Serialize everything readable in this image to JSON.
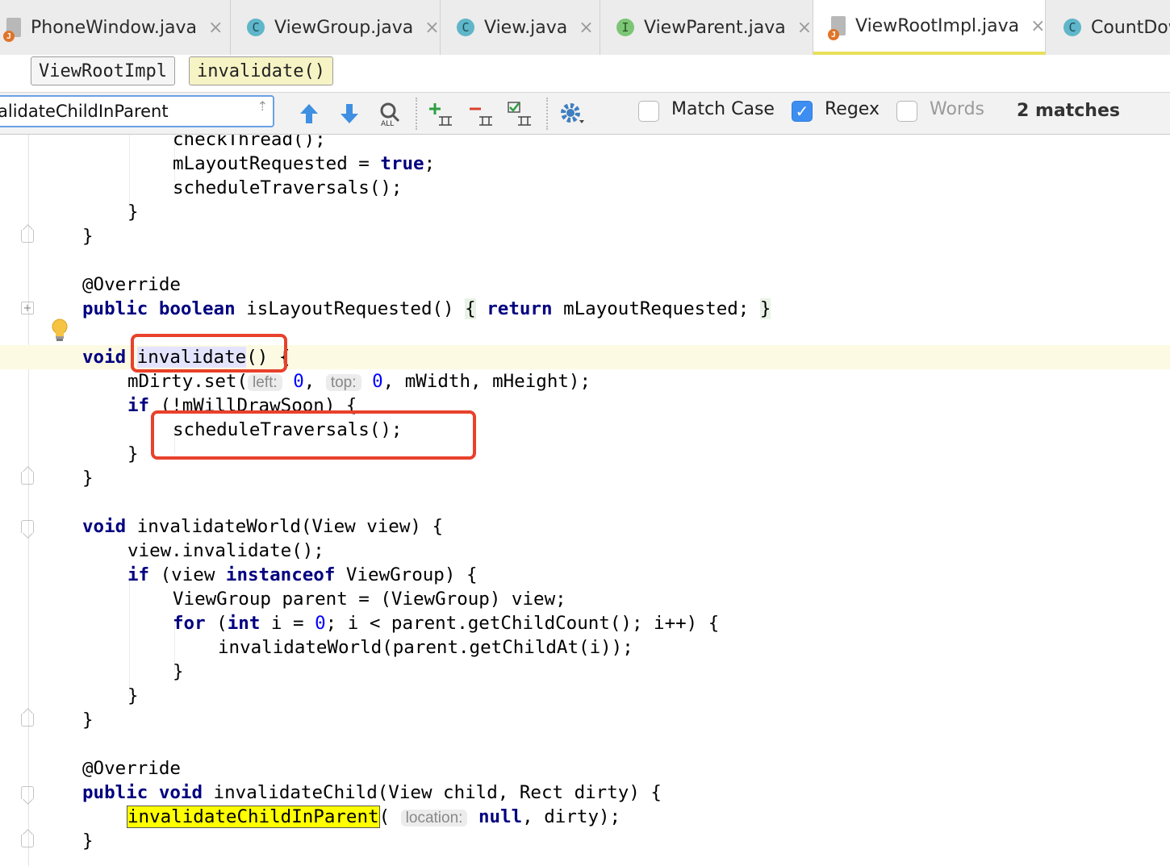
{
  "tabs": [
    {
      "label": "PhoneWindow.java",
      "icon": "java-file-icon",
      "active": false
    },
    {
      "label": "ViewGroup.java",
      "icon": "class-icon",
      "icon_letter": "C",
      "active": false
    },
    {
      "label": "View.java",
      "icon": "class-icon",
      "icon_letter": "C",
      "active": false
    },
    {
      "label": "ViewParent.java",
      "icon": "interface-icon",
      "icon_letter": "I",
      "active": false
    },
    {
      "label": "ViewRootImpl.java",
      "icon": "java-file-icon",
      "active": true
    },
    {
      "label": "CountDow",
      "icon": "class-icon",
      "icon_letter": "C",
      "active": false
    }
  ],
  "close_glyph": "×",
  "breadcrumb": {
    "class": "ViewRootImpl",
    "method": "invalidate()"
  },
  "find": {
    "query": "alidateChildInParent",
    "match_case_label": "Match Case",
    "match_case_checked": false,
    "regex_label": "Regex",
    "regex_checked": true,
    "words_label": "Words",
    "words_checked": false,
    "matches": "2 matches",
    "toolbar_icons": [
      "previous-occurrence-icon",
      "next-occurrence-icon",
      "find-all-icon",
      "add-occurrence-icon",
      "remove-occurrence-icon",
      "select-all-occurrences-icon",
      "settings-icon"
    ]
  },
  "code": {
    "l1": "checkThread();",
    "l2a": "mLayoutRequested = ",
    "l2kw": "true",
    "l2b": ";",
    "l3": "scheduleTraversals();",
    "l4": "}",
    "l5": "}",
    "l7": "@Override",
    "l8kw1": "public",
    "l8kw2": "boolean",
    "l8a": "isLayoutRequested()",
    "l8b": "{",
    "l8kw3": "return",
    "l8c": "mLayoutRequested;",
    "l8d": "}",
    "l10kw": "void",
    "l10sel": "invalidate",
    "l10a": "()",
    "l10b": "{",
    "l11a": "mDirty.set(",
    "l11hint1": "left:",
    "l11num1": "0",
    "l11b": ",",
    "l11hint2": "top:",
    "l11num2": "0",
    "l11c": ", mWidth, mHeight);",
    "l12kw": "if",
    "l12a": " (!mWillDrawSoon) {",
    "l13": "scheduleTraversals();",
    "l14": "}",
    "l15": "}",
    "l17kw": "void",
    "l17a": " invalidateWorld(View view) {",
    "l18": "view.invalidate();",
    "l19kw": "if",
    "l19a": " (view ",
    "l19kw2": "instanceof",
    "l19b": " ViewGroup) {",
    "l20": "ViewGroup parent = (ViewGroup) view;",
    "l21kw": "for",
    "l21a": " (",
    "l21kw2": "int",
    "l21b": " i = ",
    "l21num": "0",
    "l21c": "; i < parent.getChildCount(); i++) {",
    "l22": "invalidateWorld(parent.getChildAt(i));",
    "l23": "}",
    "l24": "}",
    "l25": "}",
    "l27": "@Override",
    "l28kw1": "public",
    "l28kw2": "void",
    "l28a": " invalidateChild(View child, Rect dirty) {",
    "l29hl": "invalidateChildInParent",
    "l29a": "(",
    "l29hint": "location:",
    "l29kw": "null",
    "l29b": ", dirty);",
    "l30": "}"
  },
  "colors": {
    "keyword": "#000080",
    "number": "#0000ff",
    "annotation_box": "#e8412c",
    "search_highlight": "#ffff00"
  }
}
